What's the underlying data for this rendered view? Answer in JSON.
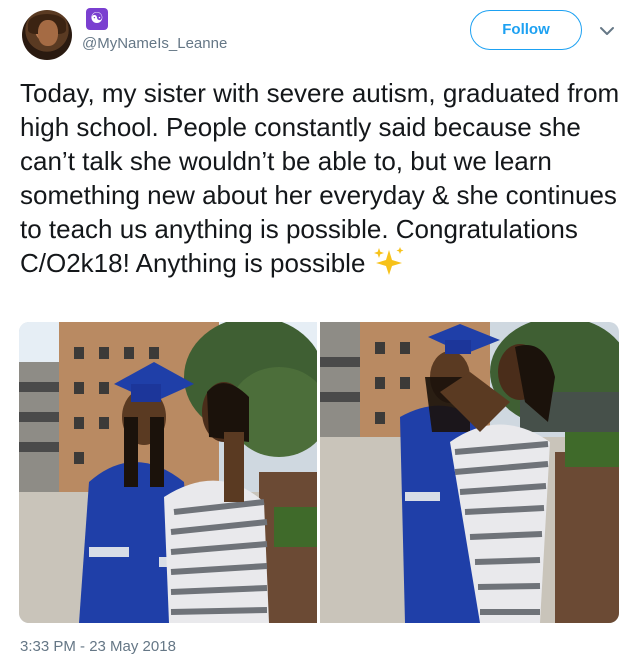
{
  "tweet": {
    "handle": "@MyNameIs_Leanne",
    "handle_icon": "yin-yang-icon",
    "follow_label": "Follow",
    "text": "Today, my sister with severe autism, graduated from high school. People constantly said because she can’t talk she wouldn’t be able to, but we learn something new about her everyday & she continues to teach us anything is possible. Congratulations C/O2k18! Anything is possible",
    "emoji": "sparkles-icon",
    "timestamp": "3:33 PM - 23 May 2018"
  },
  "photos": [
    {
      "name": "graduation-photo-left"
    },
    {
      "name": "graduation-photo-right"
    }
  ],
  "colors": {
    "accent": "#1da1f2",
    "text": "#14171a",
    "secondary_text": "#657786",
    "gown_blue": "#1f3fa8"
  }
}
